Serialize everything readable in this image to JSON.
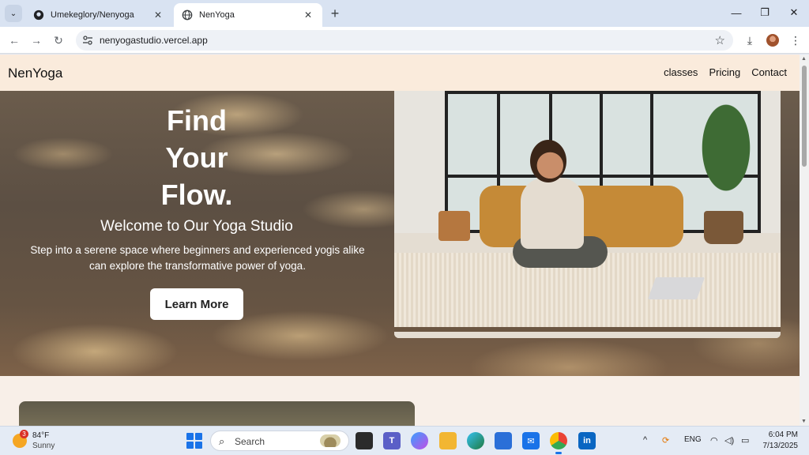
{
  "browser": {
    "tabs": [
      {
        "title": "Umekeglory/Nenyoga",
        "active": false
      },
      {
        "title": "NenYoga",
        "active": true
      }
    ],
    "close_glyph": "✕",
    "new_tab_glyph": "+",
    "address": "nenyogastudio.vercel.app",
    "window_controls": {
      "minimize": "—",
      "maximize": "❐",
      "close": "✕"
    }
  },
  "site": {
    "brand": "NenYoga",
    "nav": [
      "classes",
      "Pricing",
      "Contact"
    ],
    "hero": {
      "headline": [
        "Find",
        "Your",
        "Flow."
      ],
      "subheading": "Welcome to Our Yoga Studio",
      "description": "Step into a serene space where beginners and experienced yogis alike can explore the transformative power of yoga.",
      "cta": "Learn More"
    }
  },
  "taskbar": {
    "weather": {
      "badge": "3",
      "temp": "84°F",
      "condition": "Sunny"
    },
    "search_label": "Search",
    "tray": {
      "language": "ENG"
    },
    "clock": {
      "time": "6:04 PM",
      "date": "7/13/2025"
    }
  },
  "colors": {
    "nav_bg": "#faebdc",
    "page_bg": "#f8efe8",
    "accent_blue": "#1a73e8"
  }
}
